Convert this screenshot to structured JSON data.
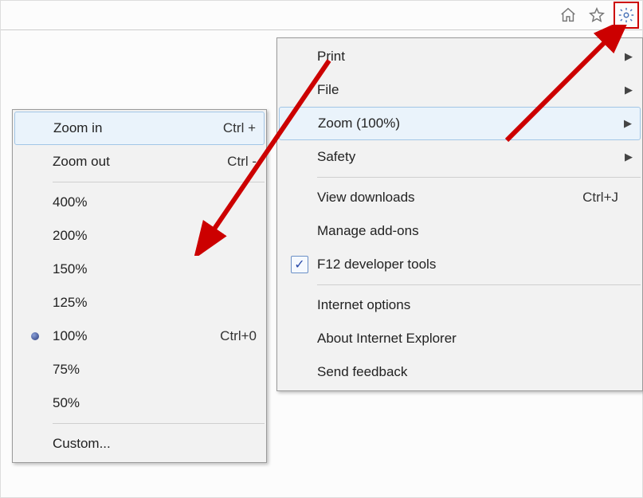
{
  "toolbar": {
    "home_icon": "home-icon",
    "favorites_icon": "star-icon",
    "tools_icon": "gear-icon"
  },
  "tools_menu": {
    "print": "Print",
    "file": "File",
    "zoom": "Zoom (100%)",
    "safety": "Safety",
    "view_downloads": "View downloads",
    "view_downloads_shortcut": "Ctrl+J",
    "manage_addons": "Manage add-ons",
    "f12": "F12 developer tools",
    "internet_options": "Internet options",
    "about": "About Internet Explorer",
    "send_feedback": "Send feedback"
  },
  "zoom_menu": {
    "zoom_in": "Zoom in",
    "zoom_in_shortcut": "Ctrl +",
    "zoom_out": "Zoom out",
    "zoom_out_shortcut": "Ctrl -",
    "levels": {
      "l400": "400%",
      "l200": "200%",
      "l150": "150%",
      "l125": "125%",
      "l100": "100%",
      "l100_shortcut": "Ctrl+0",
      "l75": "75%",
      "l50": "50%"
    },
    "custom": "Custom..."
  },
  "annotations": {
    "highlight_color": "#c00"
  }
}
